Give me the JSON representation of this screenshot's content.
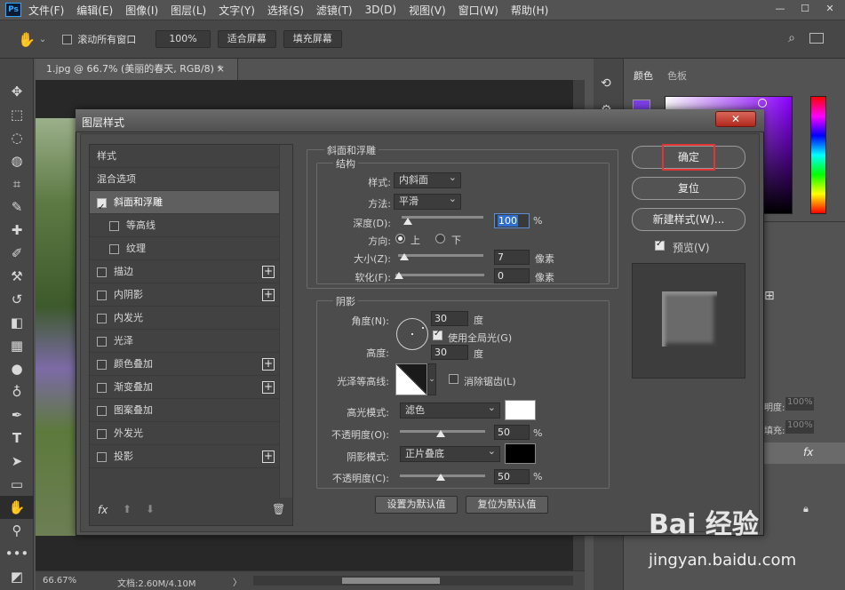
{
  "menubar": {
    "logo": "Ps",
    "items": [
      "文件(F)",
      "编辑(E)",
      "图像(I)",
      "图层(L)",
      "文字(Y)",
      "选择(S)",
      "滤镜(T)",
      "3D(D)",
      "视图(V)",
      "窗口(W)",
      "帮助(H)"
    ],
    "window_buttons": [
      "—",
      "☐",
      "✕"
    ]
  },
  "options_bar": {
    "scroll_all_label": "滚动所有窗口",
    "zoom_value": "100%",
    "fit_screen_label": "适合屏幕",
    "fill_screen_label": "填充屏幕"
  },
  "document": {
    "tab_title": "1.jpg @ 66.7% (美丽的春天, RGB/8) *",
    "tab_close": "×"
  },
  "status": {
    "zoom": "66.67%",
    "doc_info": "文档:2.60M/4.10M",
    "arrow": "〉"
  },
  "panels": {
    "color_tab": "颜色",
    "swatches_tab": "色板",
    "opacity_label": "明度:",
    "opacity_value": "100%",
    "fill_label": "填充:",
    "fill_value": "100%",
    "fx_label": "fx"
  },
  "dialog": {
    "title": "图层样式",
    "close": "✕",
    "style_list": [
      {
        "label": "样式",
        "has_checkbox": false,
        "checked": false,
        "has_plus": false,
        "sub": false,
        "selected": false
      },
      {
        "label": "混合选项",
        "has_checkbox": false,
        "checked": false,
        "has_plus": false,
        "sub": false,
        "selected": false
      },
      {
        "label": "斜面和浮雕",
        "has_checkbox": true,
        "checked": true,
        "has_plus": false,
        "sub": false,
        "selected": true
      },
      {
        "label": "等高线",
        "has_checkbox": true,
        "checked": false,
        "has_plus": false,
        "sub": true,
        "selected": false
      },
      {
        "label": "纹理",
        "has_checkbox": true,
        "checked": false,
        "has_plus": false,
        "sub": true,
        "selected": false
      },
      {
        "label": "描边",
        "has_checkbox": true,
        "checked": false,
        "has_plus": true,
        "sub": false,
        "selected": false
      },
      {
        "label": "内阴影",
        "has_checkbox": true,
        "checked": false,
        "has_plus": true,
        "sub": false,
        "selected": false
      },
      {
        "label": "内发光",
        "has_checkbox": true,
        "checked": false,
        "has_plus": false,
        "sub": false,
        "selected": false
      },
      {
        "label": "光泽",
        "has_checkbox": true,
        "checked": false,
        "has_plus": false,
        "sub": false,
        "selected": false
      },
      {
        "label": "颜色叠加",
        "has_checkbox": true,
        "checked": false,
        "has_plus": true,
        "sub": false,
        "selected": false
      },
      {
        "label": "渐变叠加",
        "has_checkbox": true,
        "checked": false,
        "has_plus": true,
        "sub": false,
        "selected": false
      },
      {
        "label": "图案叠加",
        "has_checkbox": true,
        "checked": false,
        "has_plus": false,
        "sub": false,
        "selected": false
      },
      {
        "label": "外发光",
        "has_checkbox": true,
        "checked": false,
        "has_plus": false,
        "sub": false,
        "selected": false
      },
      {
        "label": "投影",
        "has_checkbox": true,
        "checked": false,
        "has_plus": true,
        "sub": false,
        "selected": false
      }
    ],
    "footer_fx": "fx",
    "bevel": {
      "section_title": "斜面和浮雕",
      "structure_title": "结构",
      "style_label": "样式:",
      "style_value": "内斜面",
      "technique_label": "方法:",
      "technique_value": "平滑",
      "depth_label": "深度(D):",
      "depth_value": "100",
      "depth_unit": "%",
      "direction_label": "方向:",
      "dir_up": "上",
      "dir_down": "下",
      "size_label": "大小(Z):",
      "size_value": "7",
      "size_unit": "像素",
      "soften_label": "软化(F):",
      "soften_value": "0",
      "soften_unit": "像素"
    },
    "shading": {
      "title": "阴影",
      "angle_label": "角度(N):",
      "angle_value": "30",
      "angle_unit": "度",
      "global_light_label": "使用全局光(G)",
      "altitude_label": "高度:",
      "altitude_value": "30",
      "altitude_unit": "度",
      "gloss_contour_label": "光泽等高线:",
      "antialias_label": "消除锯齿(L)",
      "highlight_mode_label": "高光模式:",
      "highlight_mode_value": "滤色",
      "highlight_color": "#ffffff",
      "highlight_opacity_label": "不透明度(O):",
      "highlight_opacity_value": "50",
      "shadow_mode_label": "阴影模式:",
      "shadow_mode_value": "正片叠底",
      "shadow_color": "#000000",
      "shadow_opacity_label": "不透明度(C):",
      "shadow_opacity_value": "50",
      "percent": "%"
    },
    "make_default": "设置为默认值",
    "reset_default": "复位为默认值",
    "ok": "确定",
    "reset": "复位",
    "new_style": "新建样式(W)...",
    "preview_label": "预览(V)"
  },
  "watermark": {
    "brand": "Bai 经验",
    "url": "jingyan.baidu.com"
  },
  "colors": {
    "accent_highlight": "#e23535",
    "foreground_swatch": "#7b3fe4"
  }
}
